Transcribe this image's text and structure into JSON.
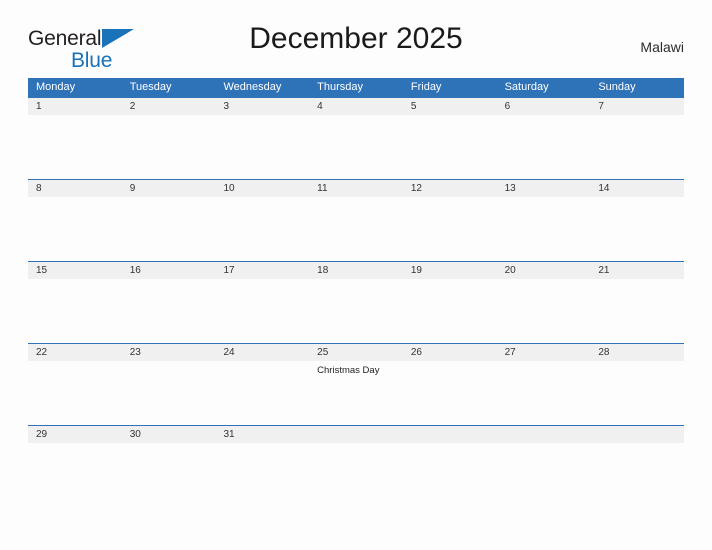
{
  "brand": {
    "line1": "General",
    "line2": "Blue",
    "flag_icon": "triangle-flag-icon",
    "accent_color": "#1a72b8"
  },
  "header": {
    "title": "December 2025",
    "country": "Malawi"
  },
  "colors": {
    "header_blue": "#2e72b8",
    "date_band": "#f0f0f0",
    "page_background": "#fdfdfd",
    "text": "#333333"
  },
  "calendar": {
    "month": "December",
    "year": "2025",
    "week_start": "Monday",
    "weekdays": [
      "Monday",
      "Tuesday",
      "Wednesday",
      "Thursday",
      "Friday",
      "Saturday",
      "Sunday"
    ],
    "weeks": [
      {
        "days": [
          {
            "date": "1",
            "event": ""
          },
          {
            "date": "2",
            "event": ""
          },
          {
            "date": "3",
            "event": ""
          },
          {
            "date": "4",
            "event": ""
          },
          {
            "date": "5",
            "event": ""
          },
          {
            "date": "6",
            "event": ""
          },
          {
            "date": "7",
            "event": ""
          }
        ]
      },
      {
        "days": [
          {
            "date": "8",
            "event": ""
          },
          {
            "date": "9",
            "event": ""
          },
          {
            "date": "10",
            "event": ""
          },
          {
            "date": "11",
            "event": ""
          },
          {
            "date": "12",
            "event": ""
          },
          {
            "date": "13",
            "event": ""
          },
          {
            "date": "14",
            "event": ""
          }
        ]
      },
      {
        "days": [
          {
            "date": "15",
            "event": ""
          },
          {
            "date": "16",
            "event": ""
          },
          {
            "date": "17",
            "event": ""
          },
          {
            "date": "18",
            "event": ""
          },
          {
            "date": "19",
            "event": ""
          },
          {
            "date": "20",
            "event": ""
          },
          {
            "date": "21",
            "event": ""
          }
        ]
      },
      {
        "days": [
          {
            "date": "22",
            "event": ""
          },
          {
            "date": "23",
            "event": ""
          },
          {
            "date": "24",
            "event": ""
          },
          {
            "date": "25",
            "event": "Christmas Day"
          },
          {
            "date": "26",
            "event": ""
          },
          {
            "date": "27",
            "event": ""
          },
          {
            "date": "28",
            "event": ""
          }
        ]
      },
      {
        "days": [
          {
            "date": "29",
            "event": ""
          },
          {
            "date": "30",
            "event": ""
          },
          {
            "date": "31",
            "event": ""
          },
          {
            "date": "",
            "event": ""
          },
          {
            "date": "",
            "event": ""
          },
          {
            "date": "",
            "event": ""
          },
          {
            "date": "",
            "event": ""
          }
        ]
      }
    ]
  }
}
